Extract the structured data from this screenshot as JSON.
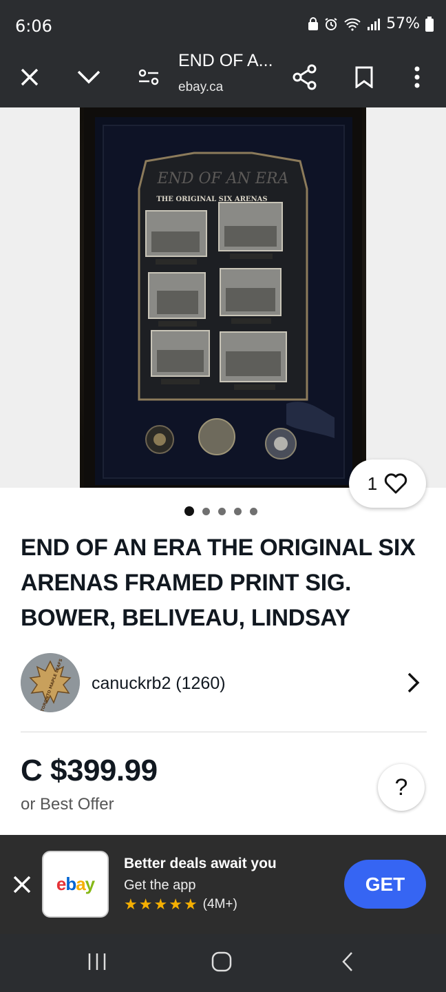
{
  "status_bar": {
    "time": "6:06",
    "battery": "57%"
  },
  "toolbar": {
    "title": "END OF A...",
    "url": "ebay.ca"
  },
  "photo": {
    "print_heading": "END OF AN ERA",
    "print_subheading": "THE ORIGINAL SIX ARENAS"
  },
  "carousel": {
    "dot_count": 5,
    "active_index": 0
  },
  "like": {
    "count": "1"
  },
  "listing": {
    "title": "END OF AN ERA THE ORIGINAL SIX ARENAS FRAMED PRINT SIG. BOWER, BELIVEAU, LINDSAY",
    "price": "C $399.99",
    "best_offer": "or Best Offer"
  },
  "seller": {
    "name_feedback": "canuckrb2 (1260)",
    "avatar_text": "TORONTO MAPLE LEAFS"
  },
  "help": {
    "label": "?"
  },
  "app_banner": {
    "app_name": "ebay",
    "headline": "Better deals await you",
    "subline": "Get the app",
    "rating_count": "(4M+)",
    "get_label": "GET"
  },
  "colors": {
    "dark_bar": "#2b2d30",
    "get_button": "#3665f3",
    "star": "#f5af02"
  }
}
